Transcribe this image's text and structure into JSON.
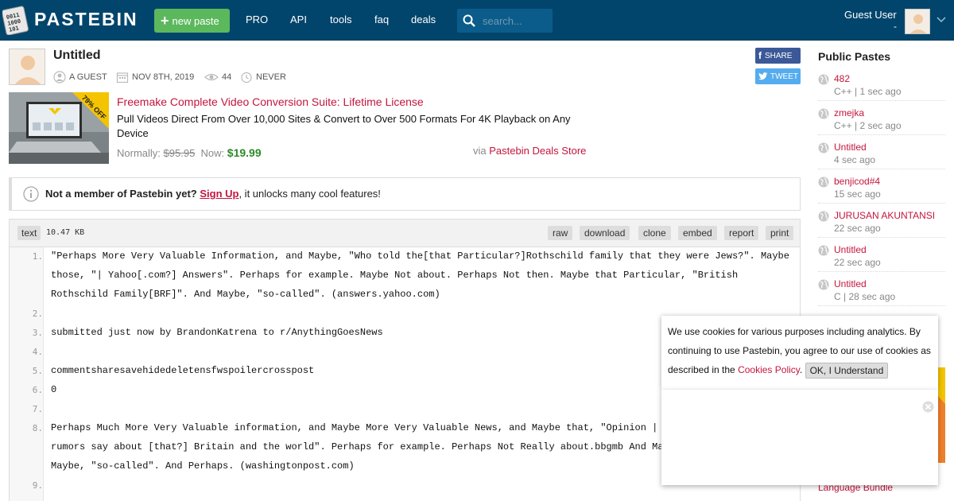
{
  "header": {
    "logo_text": "PASTEBIN",
    "new_paste_label": "new paste",
    "nav": [
      "PRO",
      "API",
      "tools",
      "faq",
      "deals"
    ],
    "search_placeholder": "search...",
    "user_name": "Guest User",
    "user_sub": "-"
  },
  "paste": {
    "title": "Untitled",
    "author": "A GUEST",
    "date": "NOV 8TH, 2019",
    "views": "44",
    "expire": "NEVER",
    "share_label": "SHARE",
    "tweet_label": "TWEET"
  },
  "deal": {
    "badge": "79% OFF",
    "title": "Freemake Complete Video Conversion Suite: Lifetime License",
    "description": "Pull Videos Direct From Over 10,000 Sites & Convert to Over 500 Formats For 4K Playback on Any Device",
    "normally_label": "Normally:",
    "old_price": "$95.95",
    "now_label": "Now:",
    "new_price": "$19.99",
    "via_label": "via",
    "store": "Pastebin Deals Store"
  },
  "notice": {
    "lead": "Not a member of Pastebin yet?",
    "signup": "Sign Up",
    "rest": ", it unlocks many cool features!"
  },
  "code": {
    "syntax": "text",
    "size": "10.47 KB",
    "actions": [
      "raw",
      "download",
      "clone",
      "embed",
      "report",
      "print"
    ],
    "lines": [
      {
        "n": "1.",
        "text": "\"Perhaps More Very Valuable Information, and Maybe, \"Who told the[that Particular?]Rothschild family that they were Jews?\". Maybe those, \"| Yahoo[.com?] Answers\". Perhaps for example. Maybe Not about. Perhaps Not then. Maybe that Particular, \"British Rothschild Family[BRF]\". And Maybe, \"so-called\". (answers.yahoo.com)"
      },
      {
        "n": "2.",
        "text": ""
      },
      {
        "n": "3.",
        "text": "submitted just now by BrandonKatrena to r/AnythingGoesNews"
      },
      {
        "n": "4.",
        "text": ""
      },
      {
        "n": "5.",
        "text": "commentsharesavehidedeletensfwspoilercrosspost"
      },
      {
        "n": "6.",
        "text": "0"
      },
      {
        "n": "7.",
        "text": ""
      },
      {
        "n": "8.",
        "text": "Perhaps Much More Very Valuable information, and Maybe More Very Valuable News, and Maybe that, \"Opinion | Wha"
      },
      {
        "n": "",
        "text": "rumors say about [that?] Britain and the world\". Perhaps for example. Perhaps Not Really about.bbgmb And Maybe"
      },
      {
        "n": "",
        "text": "Maybe, \"so-called\". And Perhaps. (washingtonpost.com)"
      },
      {
        "n": "9.",
        "text": ""
      }
    ]
  },
  "sidebar": {
    "title": "Public Pastes",
    "items": [
      {
        "name": "482",
        "sub": "C++ | 1 sec ago"
      },
      {
        "name": "zmejka",
        "sub": "C++ | 2 sec ago"
      },
      {
        "name": "Untitled",
        "sub": "4 sec ago"
      },
      {
        "name": "benjicod#4",
        "sub": "15 sec ago"
      },
      {
        "name": "JURUSAN AKUNTANSI",
        "sub": "22 sec ago"
      },
      {
        "name": "Untitled",
        "sub": "22 sec ago"
      },
      {
        "name": "Untitled",
        "sub": "C | 28 sec ago"
      }
    ],
    "bottom_link": "Language Bundle"
  },
  "cookie": {
    "text": "We use cookies for various purposes including analytics. By continuing to use Pastebin, you agree to our use of cookies as described in the",
    "link": "Cookies Policy",
    "ok_label": "OK, I Understand"
  }
}
